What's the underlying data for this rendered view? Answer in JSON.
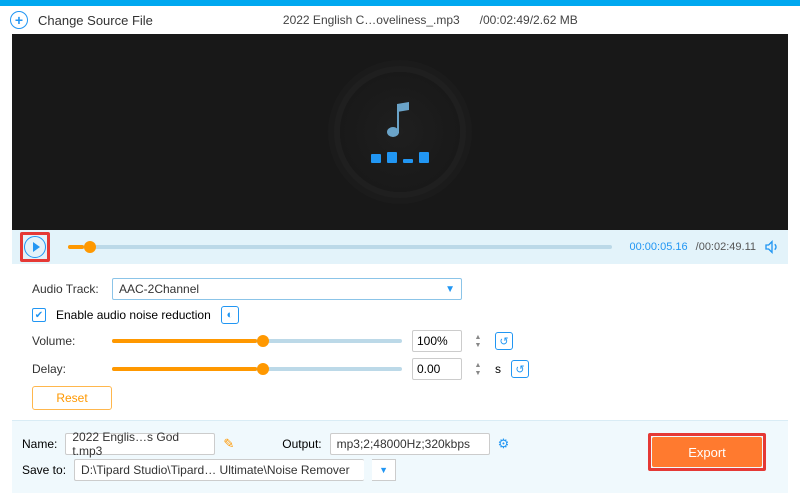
{
  "header": {
    "change_source": "Change Source File",
    "filename": "2022 English C…oveliness_.mp3",
    "duration_size": "/00:02:49/2.62 MB"
  },
  "transport": {
    "current_time": "00:00:05.16",
    "total_time": "/00:02:49.11"
  },
  "panel": {
    "audio_track_label": "Audio Track:",
    "audio_track_value": "AAC-2Channel",
    "noise_reduction_label": "Enable audio noise reduction",
    "volume_label": "Volume:",
    "volume_value": "100%",
    "delay_label": "Delay:",
    "delay_value": "0.00",
    "delay_unit": "s",
    "reset": "Reset"
  },
  "bottom": {
    "name_label": "Name:",
    "name_value": "2022 Englis…s God t.mp3",
    "output_label": "Output:",
    "output_value": "mp3;2;48000Hz;320kbps",
    "save_label": "Save to:",
    "save_value": "D:\\Tipard Studio\\Tipard… Ultimate\\Noise Remover",
    "export": "Export"
  },
  "colors": {
    "accent": "#2196f3",
    "orange": "#ff9800",
    "export": "#ff7a2f",
    "highlight": "#e53935"
  }
}
